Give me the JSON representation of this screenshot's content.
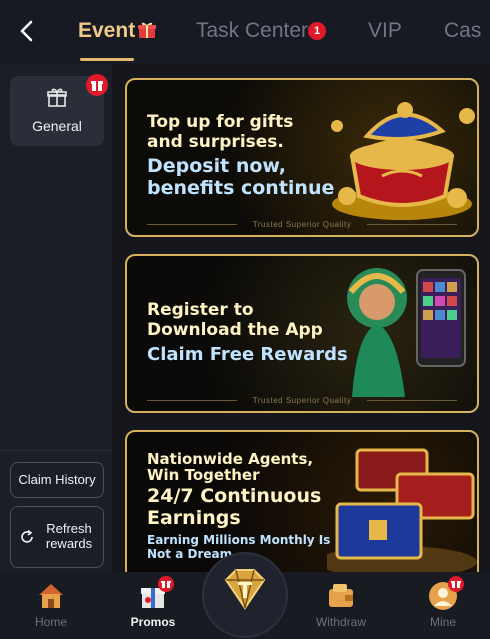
{
  "header": {
    "tabs": [
      {
        "label": "Event",
        "active": true
      },
      {
        "label": "Task Center",
        "badge": "1"
      },
      {
        "label": "VIP"
      },
      {
        "label": "Cas"
      }
    ]
  },
  "sidebar": {
    "categories": [
      {
        "label": "General",
        "active": true
      }
    ],
    "claim_history": "Claim History",
    "refresh_rewards": "Refresh rewards"
  },
  "banners": [
    {
      "lines": [
        "Top up for gifts",
        "and surprises.",
        "Deposit now,",
        "benefits continue"
      ],
      "footer": "Trusted Superior Quality"
    },
    {
      "lines": [
        "Register to",
        "Download the App",
        "Claim Free Rewards"
      ],
      "footer": "Trusted Superior Quality"
    },
    {
      "lines": [
        "Nationwide Agents,",
        "Win Together",
        "24/7 Continuous",
        "Earnings",
        "Earning Millions Monthly Is",
        "Not a Dream"
      ]
    }
  ],
  "bottom_nav": [
    {
      "label": "Home",
      "icon": "home-icon"
    },
    {
      "label": "Promos",
      "icon": "gift-box-icon",
      "active": true
    },
    {
      "label": "",
      "icon": "diamond-logo-icon"
    },
    {
      "label": "Withdraw",
      "icon": "wallet-icon"
    },
    {
      "label": "Mine",
      "icon": "user-icon"
    }
  ],
  "colors": {
    "accent": "#f0c887",
    "badge": "#e01a2b",
    "gold_border": "#d6b15e"
  }
}
